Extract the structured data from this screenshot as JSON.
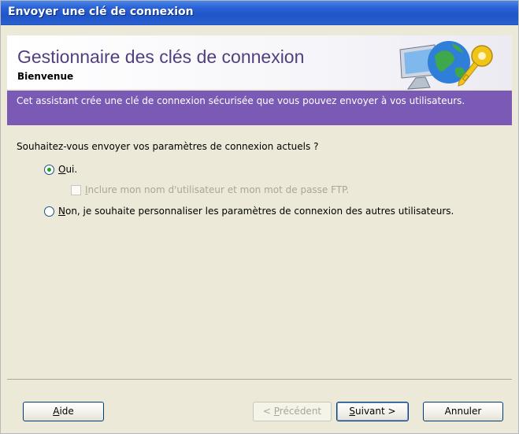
{
  "window": {
    "title": "Envoyer une clé de connexion"
  },
  "header": {
    "title": "Gestionnaire des clés de connexion",
    "subtitle": "Bienvenue",
    "art_icons": [
      "computer-icon",
      "globe-icon",
      "key-icon"
    ]
  },
  "banner": {
    "text": "Cet assistant crée une clé de connexion sécurisée que vous pouvez envoyer à vos utilisateurs."
  },
  "content": {
    "question": "Souhaitez-vous envoyer vos paramètres de connexion actuels ?",
    "options": [
      {
        "mnemonic": "O",
        "rest": "ui.",
        "checked": true
      },
      {
        "mnemonic": "N",
        "rest": "on, je souhaite personnaliser les paramètres de connexion des autres utilisateurs.",
        "checked": false
      }
    ],
    "include_credentials": {
      "mnemonic": "I",
      "rest": "nclure mon nom d'utilisateur et mon mot de passe FTP.",
      "checked": false,
      "enabled": false
    }
  },
  "footer": {
    "help": {
      "mnemonic": "A",
      "rest": "ide"
    },
    "back": {
      "prefix": "< ",
      "mnemonic": "P",
      "rest": "récédent",
      "enabled": false
    },
    "next": {
      "mnemonic": "S",
      "rest": "uivant >"
    },
    "cancel": {
      "label": "Annuler"
    }
  },
  "colors": {
    "titlebar": "#2a62d6",
    "header_title": "#533e7e",
    "banner": "#7a5ab4",
    "dialog_bg": "#ece9d8"
  }
}
